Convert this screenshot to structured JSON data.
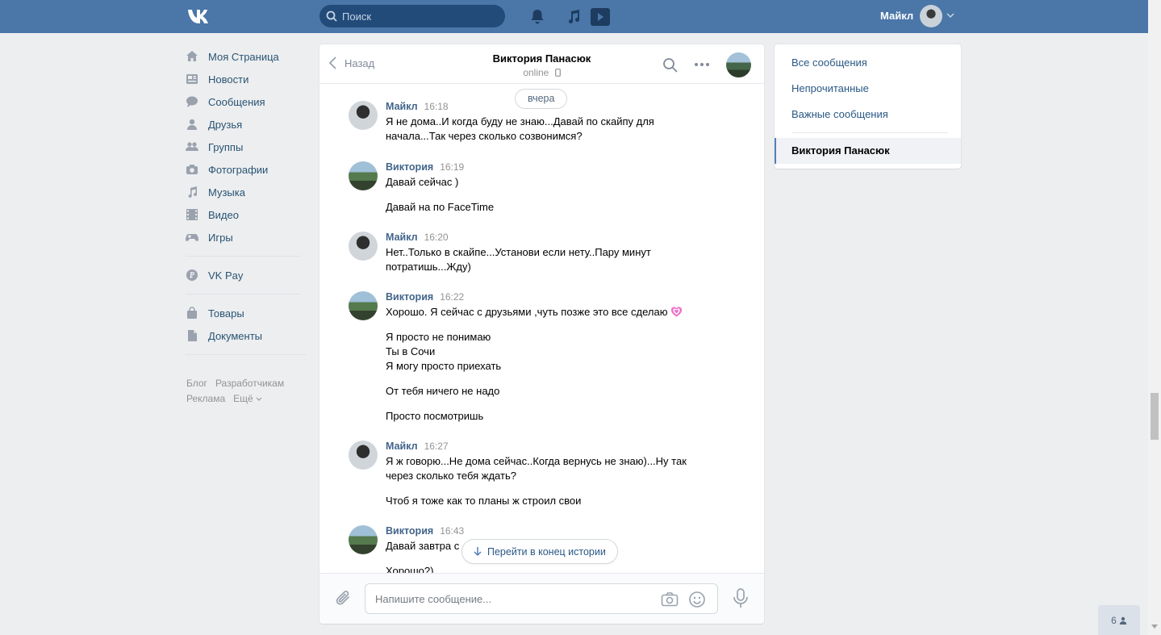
{
  "header": {
    "search_placeholder": "Поиск",
    "user_name": "Майкл",
    "icons": [
      "bell-icon",
      "music-icon",
      "video-icon"
    ]
  },
  "left_menu": {
    "items": [
      {
        "label": "Моя Страница",
        "icon": "home-icon"
      },
      {
        "label": "Новости",
        "icon": "news-icon"
      },
      {
        "label": "Сообщения",
        "icon": "messages-icon"
      },
      {
        "label": "Друзья",
        "icon": "friends-icon"
      },
      {
        "label": "Группы",
        "icon": "groups-icon"
      },
      {
        "label": "Фотографии",
        "icon": "camera-icon"
      },
      {
        "label": "Музыка",
        "icon": "music-icon"
      },
      {
        "label": "Видео",
        "icon": "video-icon"
      },
      {
        "label": "Игры",
        "icon": "gamepad-icon"
      }
    ],
    "vkpay": "VK Pay",
    "items2": [
      {
        "label": "Товары",
        "icon": "bag-icon"
      },
      {
        "label": "Документы",
        "icon": "document-icon"
      }
    ],
    "footer": [
      "Блог",
      "Разработчикам",
      "Реклама",
      "Ещё"
    ]
  },
  "chat": {
    "back_label": "Назад",
    "title": "Виктория Панасюк",
    "status": "online",
    "day_badge": "вчера",
    "groups": [
      {
        "author": "Майкл",
        "time": "16:18",
        "messages": [
          "Я не дома..И когда буду не знаю...Давай по скайпу для начала...Так через сколько созвонимся?"
        ]
      },
      {
        "author": "Виктория",
        "time": "16:19",
        "messages": [
          "Давай сейчас )",
          "Давай на по FaceTime"
        ]
      },
      {
        "author": "Майкл",
        "time": "16:20",
        "messages": [
          "Нет..Только в скайпе...Установи если нету..Пару минут потратишь...Жду)"
        ]
      },
      {
        "author": "Виктория",
        "time": "16:22",
        "messages": [
          "Хорошо. Я сейчас с друзьями ,чуть позже это все сделаю",
          "Я просто не понимаю",
          "Ты в Сочи",
          "Я могу просто приехать",
          "От тебя ничего не надо",
          "Просто посмотришь"
        ]
      },
      {
        "author": "Майкл",
        "time": "16:27",
        "messages": [
          "Я ж говорю...Не дома сейчас..Когда вернусь не знаю)...Ну так через сколько тебя ждать?",
          "Чтоб я тоже как то планы ж строил свои"
        ]
      },
      {
        "author": "Виктория",
        "time": "16:43",
        "messages": [
          "Давай завтра с",
          "Хорошо?)"
        ]
      }
    ],
    "jump_label": "Перейти в конец истории",
    "input_placeholder": "Напишите сообщение..."
  },
  "right_panel": {
    "items": [
      "Все сообщения",
      "Непрочитанные",
      "Важные сообщения"
    ],
    "active": "Виктория Панасюк"
  },
  "friends_badge": "6",
  "colors": {
    "header": "#4a76a8",
    "link": "#2a5885",
    "bg": "#edeef0"
  }
}
